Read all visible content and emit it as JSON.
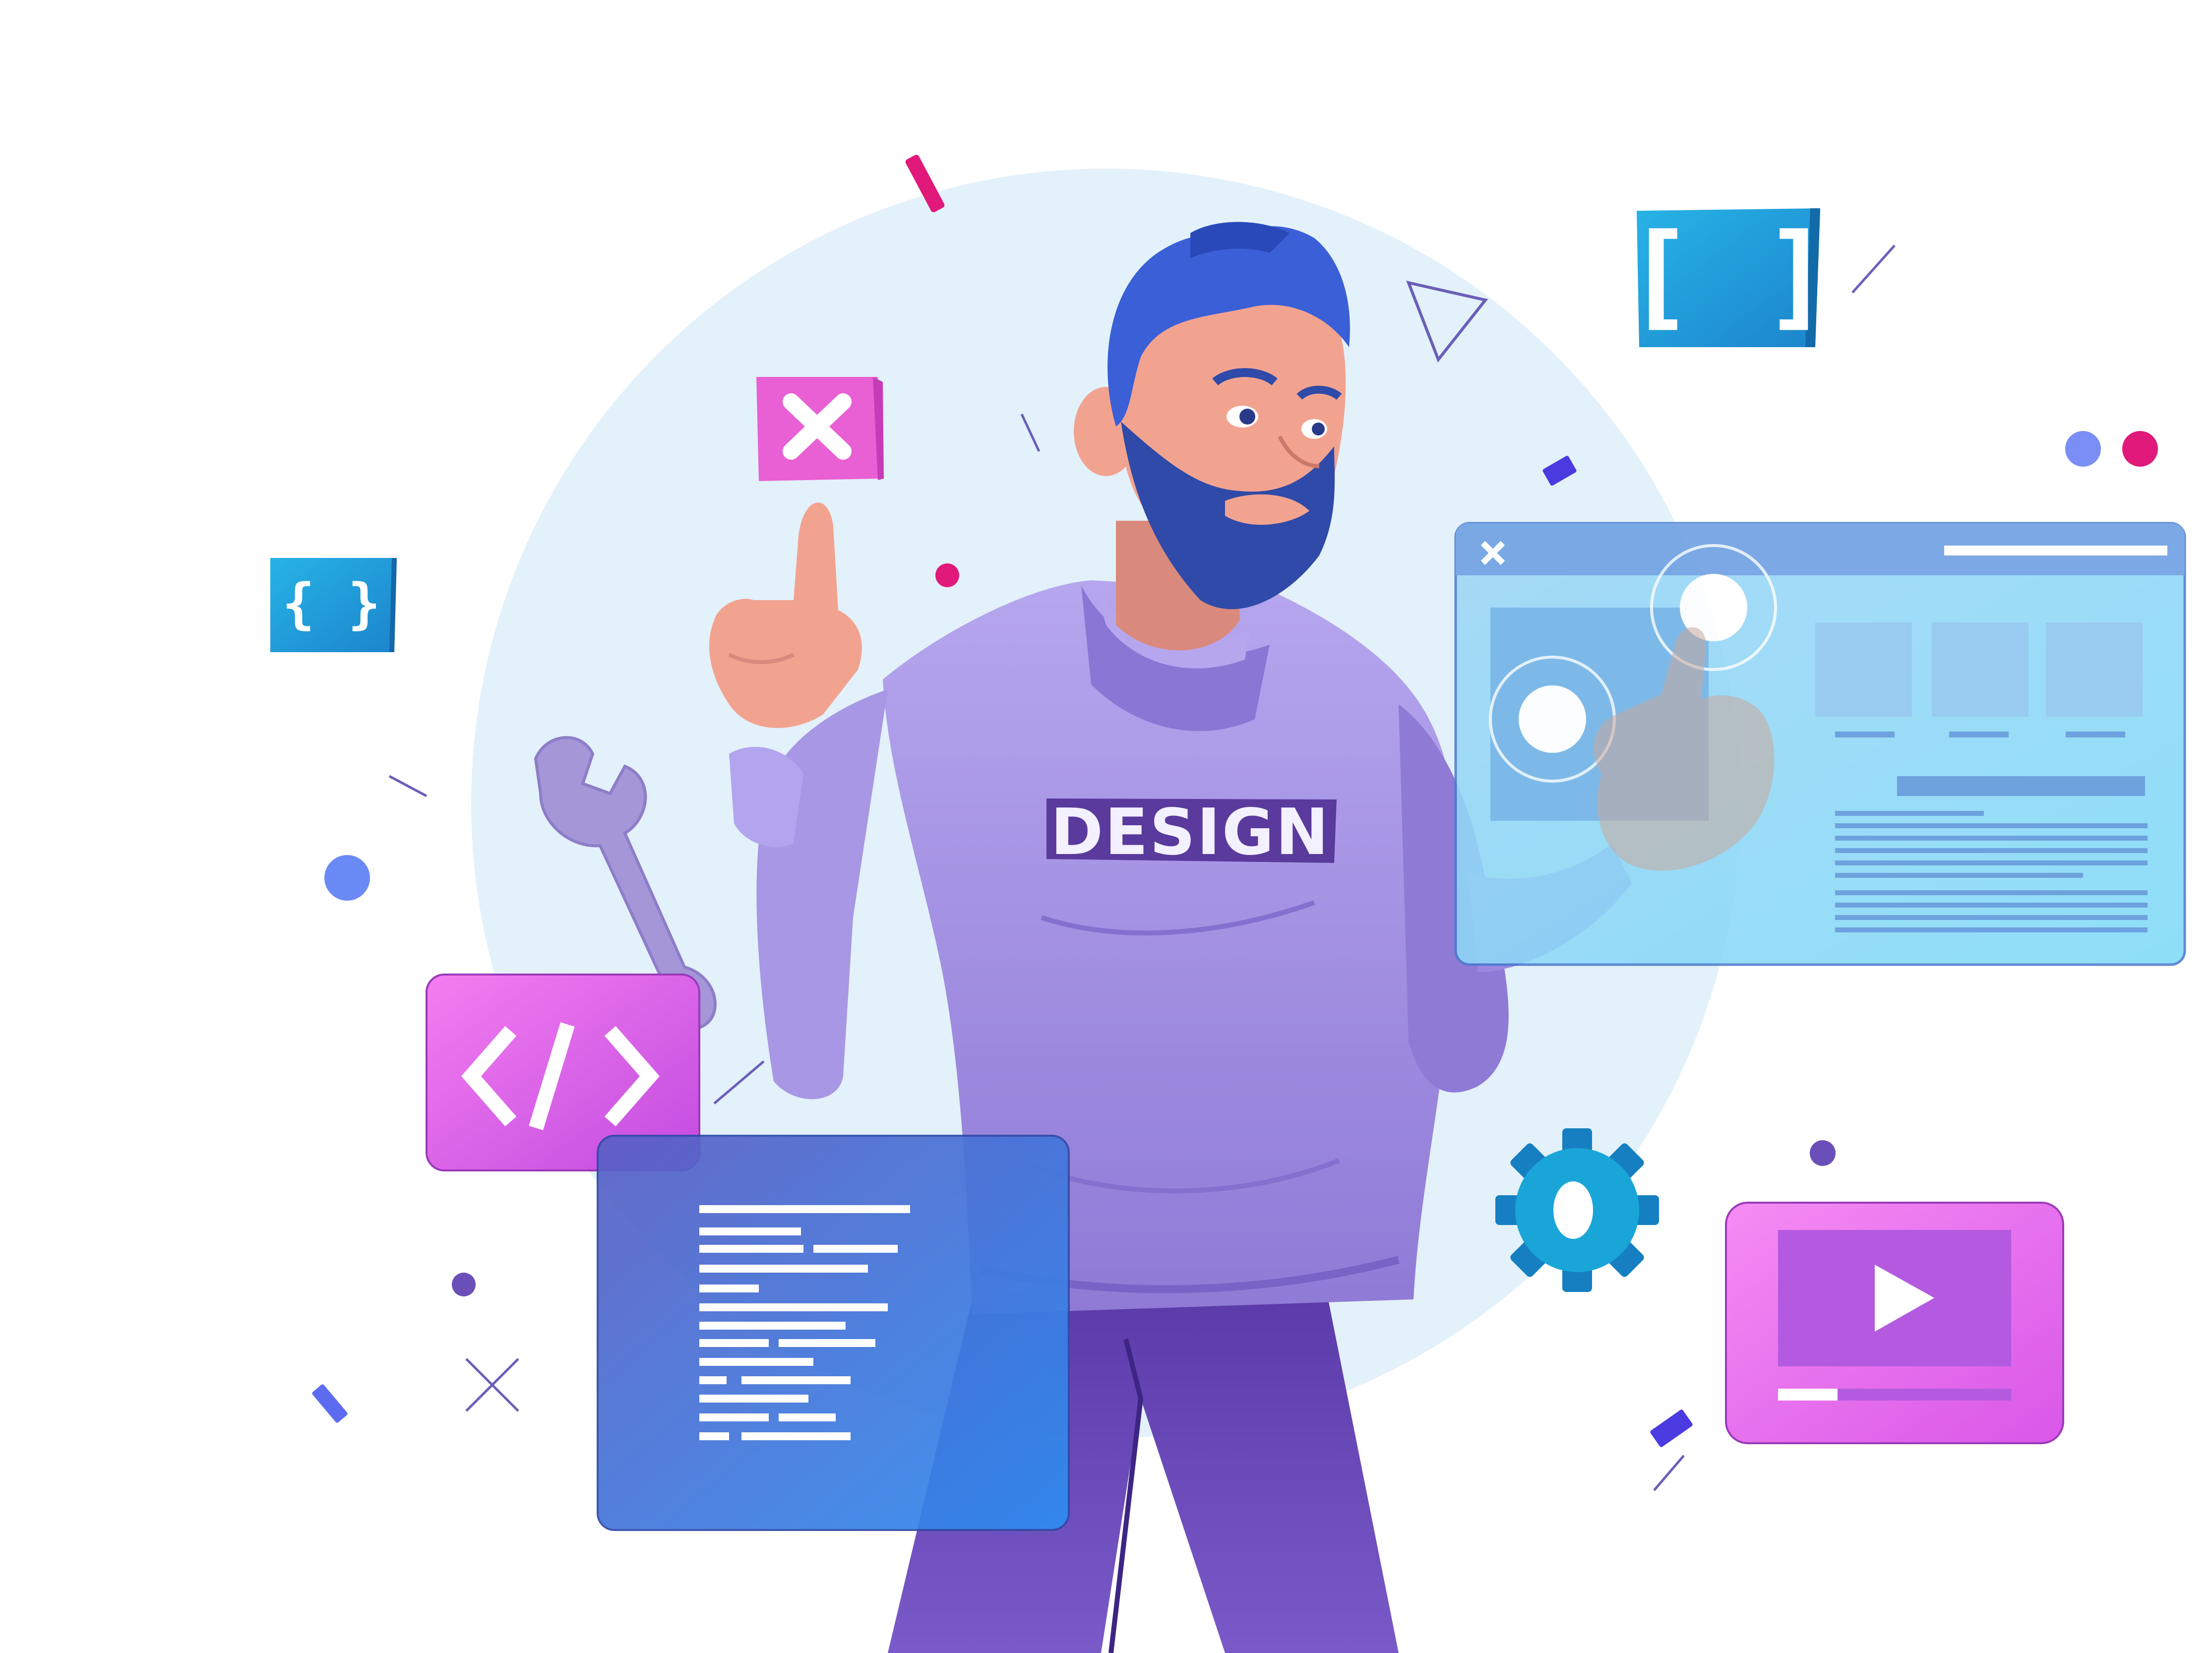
{
  "illustration": {
    "shirt_label": "DESIGN",
    "small_brace_icon_text": "{ }",
    "bracket_icon_text": "[ ]",
    "code_tag_text": "</>"
  },
  "colors": {
    "background_circle": "#e3f1fb",
    "shirt": "#9a86dc",
    "pants": "#5b3fae",
    "hair": "#3a5fd6",
    "skin": "#f2a390",
    "pink_card": "#e86ae6",
    "blue_panel": "#3f74d8",
    "browser_window": "#8fd0f2",
    "gear": "#1aa5d8",
    "accent_magenta": "#e0197a"
  },
  "icons": [
    "close-icon",
    "code-tag-icon",
    "wrench-icon",
    "gear-icon",
    "play-icon",
    "curly-braces-icon",
    "square-brackets-icon"
  ]
}
